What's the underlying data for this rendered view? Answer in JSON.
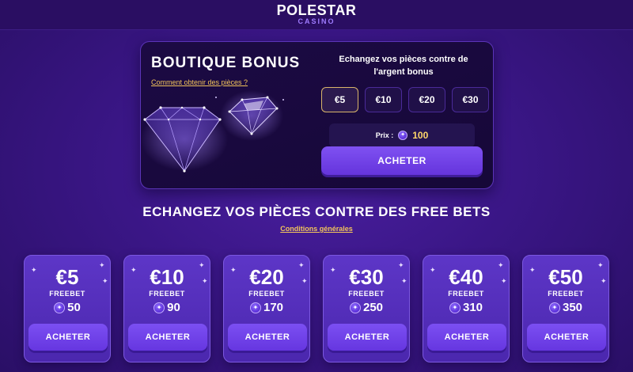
{
  "header": {
    "logo_main": "POLESTAR",
    "logo_sub": "CASINO"
  },
  "boutique": {
    "title": "BOUTIQUE BONUS",
    "help_link": "Comment obtenir des pièces ?",
    "exchange_text": "Echangez vos pièces contre de l'argent bonus",
    "amounts": [
      "€5",
      "€10",
      "€20",
      "€30"
    ],
    "selected_amount": "€5",
    "price_label": "Prix :",
    "price_value": "100",
    "buy_label": "ACHETER"
  },
  "freebets": {
    "title": "ECHANGEZ VOS PIÈCES CONTRE DES FREE BETS",
    "conditions_link": "Conditions générales",
    "cards": [
      {
        "amount": "€5",
        "label": "FREEBET",
        "price": "50",
        "button": "ACHETER"
      },
      {
        "amount": "€10",
        "label": "FREEBET",
        "price": "90",
        "button": "ACHETER"
      },
      {
        "amount": "€20",
        "label": "FREEBET",
        "price": "170",
        "button": "ACHETER"
      },
      {
        "amount": "€30",
        "label": "FREEBET",
        "price": "250",
        "button": "ACHETER"
      },
      {
        "amount": "€40",
        "label": "FREEBET",
        "price": "310",
        "button": "ACHETER"
      },
      {
        "amount": "€50",
        "label": "FREEBET",
        "price": "350",
        "button": "ACHETER"
      }
    ]
  },
  "icons": {
    "coin": "coin-icon",
    "gems": "diamond-gems-icon",
    "sparkle": "sparkle-icon"
  },
  "colors": {
    "accent": "#6b3ae6",
    "link": "#f2c45b",
    "price": "#ffd76a",
    "selected_border": "#d9b56a"
  }
}
